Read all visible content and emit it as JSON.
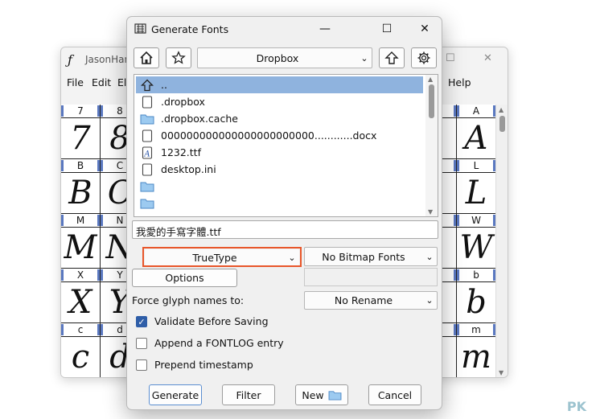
{
  "background_window": {
    "title": "JasonHan",
    "menu": [
      "File",
      "Edit",
      "Ele",
      "Help"
    ],
    "grid_rows": [
      [
        {
          "label": "7",
          "glyph": "7"
        },
        {
          "label": "8",
          "glyph": "8"
        }
      ],
      [
        {
          "label": "B",
          "glyph": "B"
        },
        {
          "label": "C",
          "glyph": "C"
        }
      ],
      [
        {
          "label": "M",
          "glyph": "M"
        },
        {
          "label": "N",
          "glyph": "N"
        }
      ],
      [
        {
          "label": "X",
          "glyph": "X"
        },
        {
          "label": "Y",
          "glyph": "Y"
        }
      ],
      [
        {
          "label": "c",
          "glyph": "c"
        },
        {
          "label": "d",
          "glyph": "d"
        }
      ]
    ],
    "grid_rows_right": [
      [
        {
          "label": "",
          "glyph": ""
        },
        {
          "label": "A",
          "glyph": "A"
        }
      ],
      [
        {
          "label": "",
          "glyph": ""
        },
        {
          "label": "L",
          "glyph": "L"
        }
      ],
      [
        {
          "label": "",
          "glyph": ""
        },
        {
          "label": "W",
          "glyph": "W"
        }
      ],
      [
        {
          "label": "",
          "glyph": ""
        },
        {
          "label": "b",
          "glyph": "b"
        }
      ],
      [
        {
          "label": "",
          "glyph": ""
        },
        {
          "label": "m",
          "glyph": "m"
        }
      ]
    ]
  },
  "dialog": {
    "title": "Generate Fonts",
    "location": "Dropbox",
    "files": [
      {
        "name": "..",
        "icon": "up-arrow-icon",
        "selected": true
      },
      {
        "name": ".dropbox",
        "icon": "file-icon"
      },
      {
        "name": ".dropbox.cache",
        "icon": "folder-icon"
      },
      {
        "name": "000000000000000000000000............docx",
        "icon": "file-icon"
      },
      {
        "name": "1232.ttf",
        "icon": "font-file-icon"
      },
      {
        "name": "desktop.ini",
        "icon": "file-icon"
      },
      {
        "name": "",
        "icon": "folder-icon"
      },
      {
        "name": "",
        "icon": "folder-icon"
      }
    ],
    "filename": "我愛的手寫字體.ttf",
    "outline_format": "TrueType",
    "bitmap_format": "No Bitmap Fonts",
    "options_label": "Options",
    "force_glyph_label": "Force glyph names to:",
    "rename_value": "No Rename",
    "checkboxes": [
      {
        "label": "Validate Before Saving",
        "checked": true
      },
      {
        "label": "Append a FONTLOG entry",
        "checked": false
      },
      {
        "label": "Prepend timestamp",
        "checked": false
      }
    ],
    "buttons": {
      "generate": "Generate",
      "filter": "Filter",
      "new": "New",
      "cancel": "Cancel"
    }
  },
  "watermark": "PK"
}
